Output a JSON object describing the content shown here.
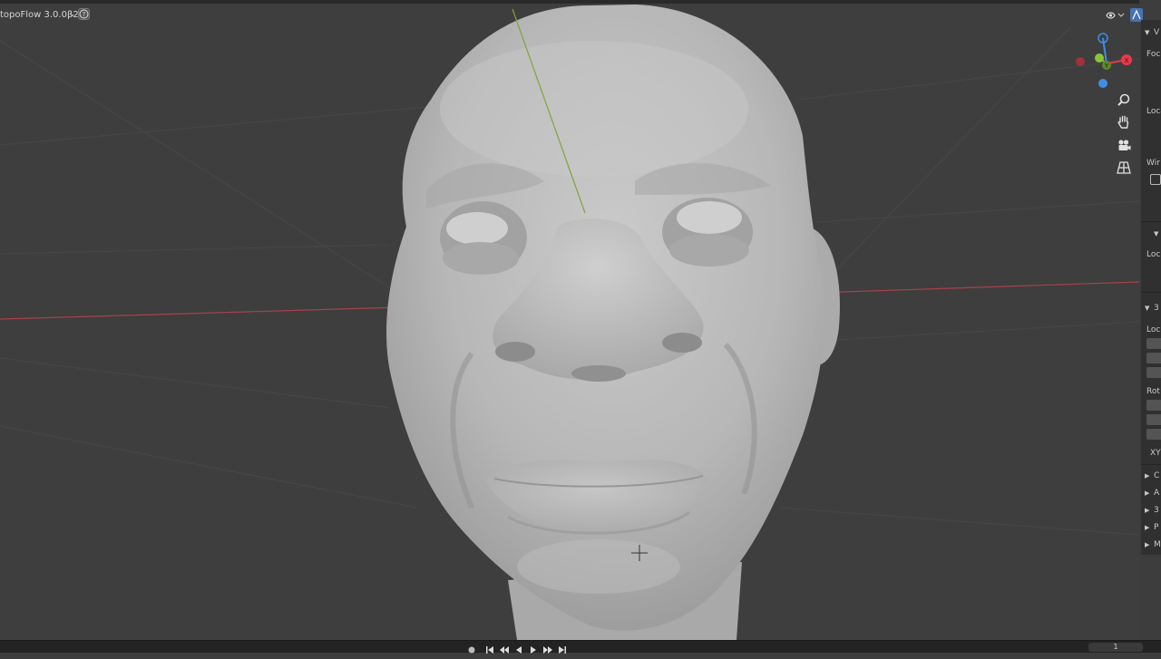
{
  "header": {
    "addon_label": "topoFlow 3.0.0β2",
    "dropdown_icon": "chevron-down-icon",
    "help_icon": "question-icon"
  },
  "viewport": {
    "subject": "sculpted head mesh",
    "axis_colors": {
      "x": "#c8434f",
      "y": "#7ea53a",
      "z": "#3f84d6"
    },
    "background": "#3e3e3e",
    "mesh_color": "#b9b9b9"
  },
  "gizmo": {
    "labels": {
      "x": "X",
      "y": "Y",
      "z": "Z"
    },
    "colors": {
      "x": "#e8394b",
      "y": "#8bc23a",
      "z": "#3e8ee6"
    }
  },
  "nav_tools": [
    "zoom-icon",
    "hand-pan-icon",
    "camera-icon",
    "grid-perspective-icon"
  ],
  "npanel": {
    "labels": {
      "view": "V",
      "focal": "Foc",
      "clip": "Loca",
      "wire": "Wir",
      "lock": "Loc",
      "transform": "3",
      "location": "Loc",
      "rotation": "Rot",
      "mode": "XY",
      "sections": [
        "C",
        "A",
        "3",
        "P",
        "M"
      ]
    }
  },
  "timeline": {
    "current_frame": "1",
    "controls": [
      "record-icon",
      "jump-start-icon",
      "prev-keyframe-icon",
      "play-reverse-icon",
      "play-icon",
      "next-keyframe-icon",
      "jump-end-icon"
    ]
  }
}
